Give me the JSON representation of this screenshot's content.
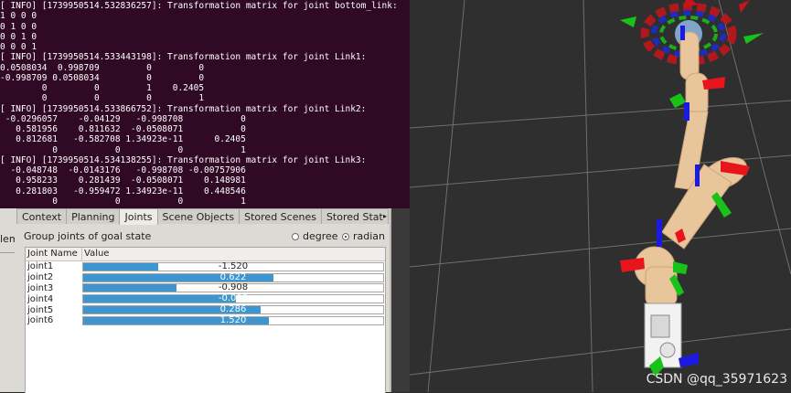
{
  "terminal": {
    "lines": [
      "[ INFO] [1739950514.532836257]: Transformation matrix for joint bottom_link:",
      "1 0 0 0",
      "0 1 0 0",
      "0 0 1 0",
      "0 0 0 1",
      "[ INFO] [1739950514.533443198]: Transformation matrix for joint Link1:",
      "0.0508034  0.998709         0         0",
      "-0.998709 0.0508034         0         0",
      "        0         0         1    0.2405",
      "        0         0         0         1",
      "[ INFO] [1739950514.533866752]: Transformation matrix for joint Link2:",
      " -0.0296057    -0.04129   -0.998708           0",
      "   0.581956    0.811632  -0.0508071           0",
      "   0.812681   -0.582708 1.34923e-11      0.2405",
      "          0           0           0           1",
      "[ INFO] [1739950514.534138255]: Transformation matrix for joint Link3:",
      "  -0.048748  -0.0143176   -0.998708 -0.00757906",
      "   0.958233    0.281439  -0.0508071    0.148981",
      "   0.281803   -0.959472 1.34923e-11    0.448546",
      "          0           0           0           1"
    ]
  },
  "left_strip": {
    "fragment": "lem"
  },
  "panel": {
    "tabs": [
      "Context",
      "Planning",
      "Joints",
      "Scene Objects",
      "Stored Scenes",
      "Stored Stat"
    ],
    "tab_scroll_glyph": "▸",
    "group_label": "Group joints of goal state",
    "unit_options": [
      "degree",
      "radian"
    ],
    "selected_unit": "radian",
    "table": {
      "headers": [
        "Joint Name",
        "Value"
      ],
      "rows": [
        {
          "name": "joint1",
          "value": "-1.520",
          "fill": 0.25
        },
        {
          "name": "joint2",
          "value": "0.622",
          "fill": 0.635
        },
        {
          "name": "joint3",
          "value": "-0.908",
          "fill": 0.31
        },
        {
          "name": "joint4",
          "value": "-0.000",
          "fill": 0.51
        },
        {
          "name": "joint5",
          "value": "0.286",
          "fill": 0.59
        },
        {
          "name": "joint6",
          "value": "1.520",
          "fill": 0.62
        }
      ]
    }
  },
  "view3d": {
    "watermark": "CSDN @qq_35971623"
  },
  "colors": {
    "terminal_bg": "#300a24",
    "bar_fill": "#3d95d1",
    "robot_link": "#e9c59b",
    "axis_red": "#e8141b",
    "axis_green": "#19c219",
    "axis_blue": "#1a1ae0"
  }
}
